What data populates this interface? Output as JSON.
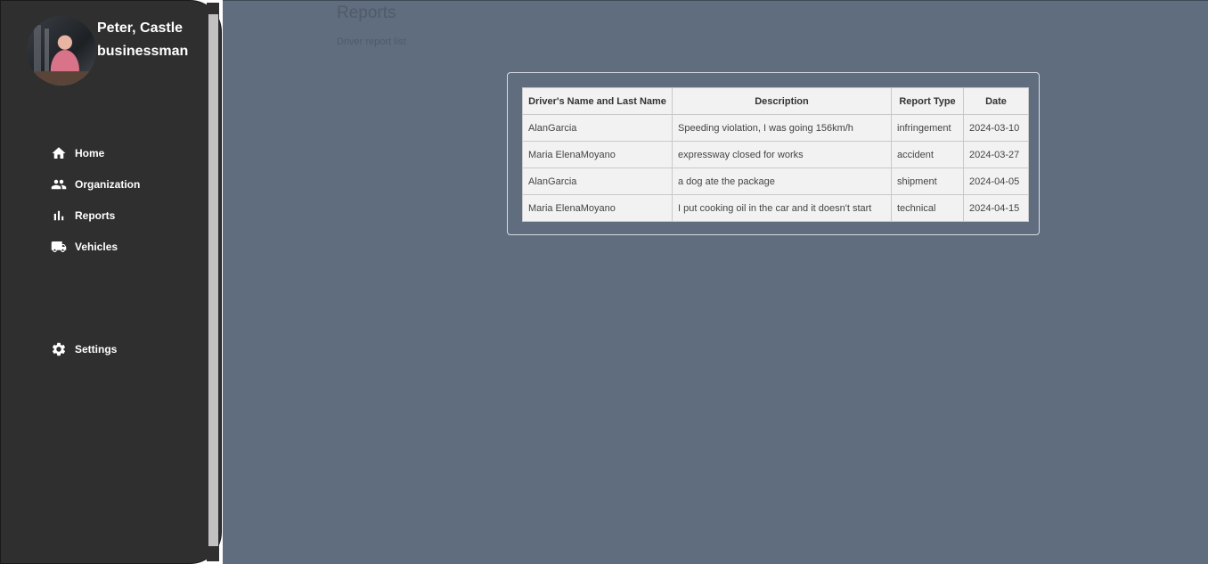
{
  "user": {
    "name": "Peter, Castle",
    "role": "businessman"
  },
  "nav": [
    {
      "label": "Home",
      "icon": "home-icon"
    },
    {
      "label": "Organization",
      "icon": "people-icon"
    },
    {
      "label": "Reports",
      "icon": "bar-chart-icon"
    },
    {
      "label": "Vehicles",
      "icon": "truck-icon"
    },
    {
      "label": "Settings",
      "icon": "gear-icon"
    }
  ],
  "page": {
    "title": "Reports",
    "subtitle": "Driver report list"
  },
  "table": {
    "headers": [
      "Driver's Name and Last Name",
      "Description",
      "Report Type",
      "Date"
    ],
    "rows": [
      [
        "AlanGarcia",
        "Speeding violation, I was going 156km/h",
        "infringement",
        "2024-03-10"
      ],
      [
        "Maria ElenaMoyano",
        "expressway closed for works",
        "accident",
        "2024-03-27"
      ],
      [
        "AlanGarcia",
        "a dog ate the package",
        "shipment",
        "2024-04-05"
      ],
      [
        "Maria ElenaMoyano",
        "I put cooking oil in the car and it doesn't start",
        "technical",
        "2024-04-15"
      ]
    ]
  },
  "colors": {
    "sidebar": "#2f2f2f",
    "background": "#5f6d7e",
    "table": "#f2f2f2"
  }
}
